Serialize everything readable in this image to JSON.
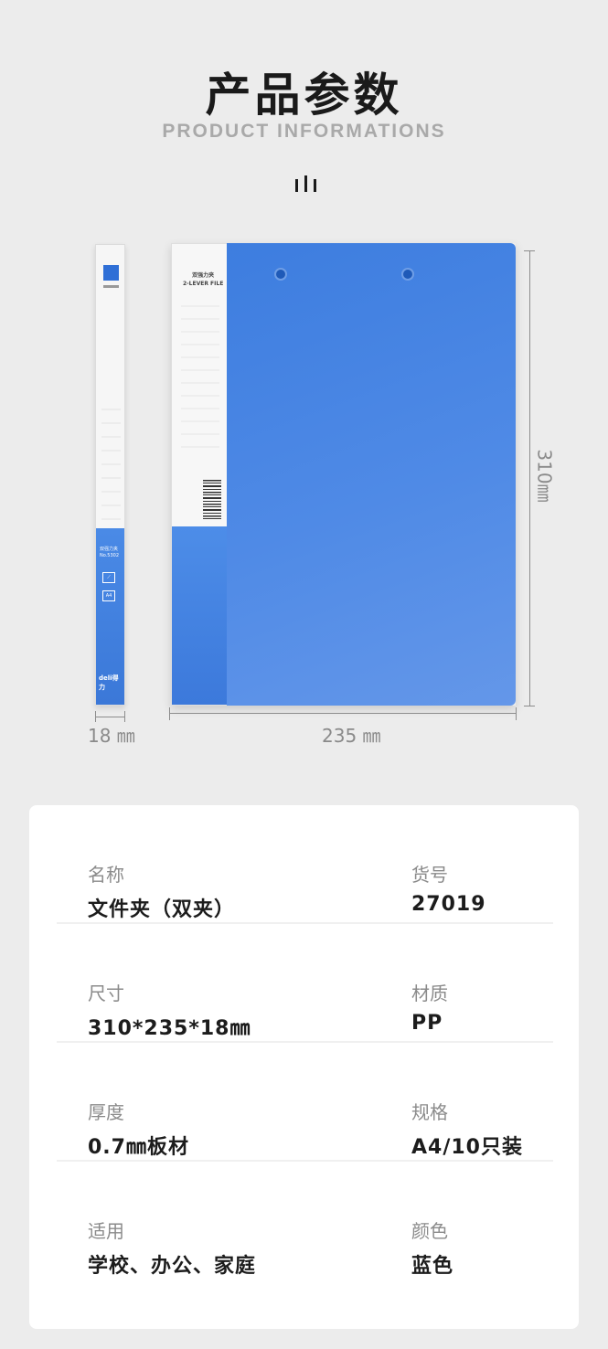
{
  "header": {
    "title": "产品参数",
    "subtitle": "PRODUCT INFORMATIONS"
  },
  "product": {
    "panel_line1": "双强力夹",
    "panel_line2": "2-LEVER  FILE",
    "spine_line1": "双强力夹",
    "spine_line2": "No.5302",
    "spine_size": "A4",
    "brand": "deli得力",
    "color_cover": "#3f7fe0",
    "dims": {
      "width": "235 ㎜",
      "height": "310㎜",
      "depth": "18 ㎜"
    }
  },
  "specs": [
    {
      "left_label": "名称",
      "left_value": "文件夹（双夹）",
      "right_label": "货号",
      "right_value": "27019"
    },
    {
      "left_label": "尺寸",
      "left_value": "310*235*18㎜",
      "right_label": "材质",
      "right_value": "PP"
    },
    {
      "left_label": "厚度",
      "left_value": "0.7㎜板材",
      "right_label": "规格",
      "right_value": "A4/10只装"
    },
    {
      "left_label": "适用",
      "left_value": "学校、办公、家庭",
      "right_label": "颜色",
      "right_value": "蓝色"
    }
  ]
}
